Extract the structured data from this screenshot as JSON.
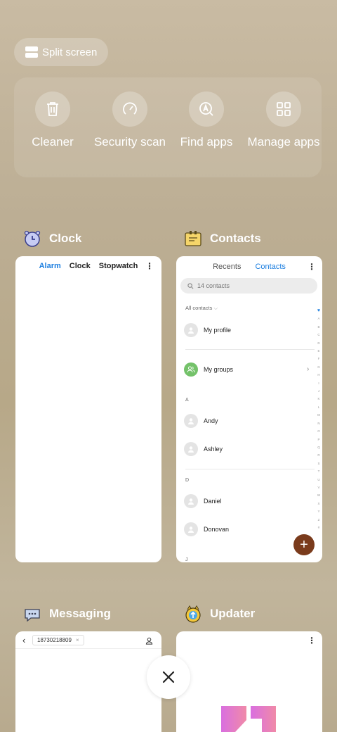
{
  "split_screen": {
    "label": "Split screen"
  },
  "tools": [
    {
      "id": "cleaner",
      "label": "Cleaner",
      "icon": "trash-icon"
    },
    {
      "id": "security",
      "label": "Security scan",
      "icon": "speedometer-icon"
    },
    {
      "id": "findapps",
      "label": "Find apps",
      "icon": "search-app-icon"
    },
    {
      "id": "manage",
      "label": "Manage apps",
      "icon": "grid-icon"
    }
  ],
  "apps": {
    "clock": {
      "title": "Clock",
      "tabs": [
        "Alarm",
        "Clock",
        "Stopwatch"
      ]
    },
    "contacts": {
      "title": "Contacts",
      "tabs": [
        "Recents",
        "Contacts"
      ],
      "search_placeholder": "14 contacts",
      "filter": "All contacts",
      "my_profile": "My profile",
      "my_groups": "My groups",
      "sections": [
        {
          "letter": "A",
          "names": [
            "Andy",
            "Ashley"
          ]
        },
        {
          "letter": "D",
          "names": [
            "Daniel",
            "Donovan"
          ]
        }
      ],
      "next_section": "J",
      "alphabet": [
        "A",
        "B",
        "C",
        "D",
        "E",
        "F",
        "G",
        "H",
        "I",
        "J",
        "K",
        "L",
        "M",
        "N",
        "O",
        "P",
        "Q",
        "R",
        "S",
        "T",
        "U",
        "V",
        "W",
        "X",
        "Y",
        "Z",
        "#"
      ]
    },
    "messaging": {
      "title": "Messaging",
      "recipient": "18730218809"
    },
    "updater": {
      "title": "Updater"
    }
  },
  "colors": {
    "accent_blue": "#1d7fe0",
    "fab_brown": "#7a3b1c",
    "group_green": "#74c26a"
  }
}
